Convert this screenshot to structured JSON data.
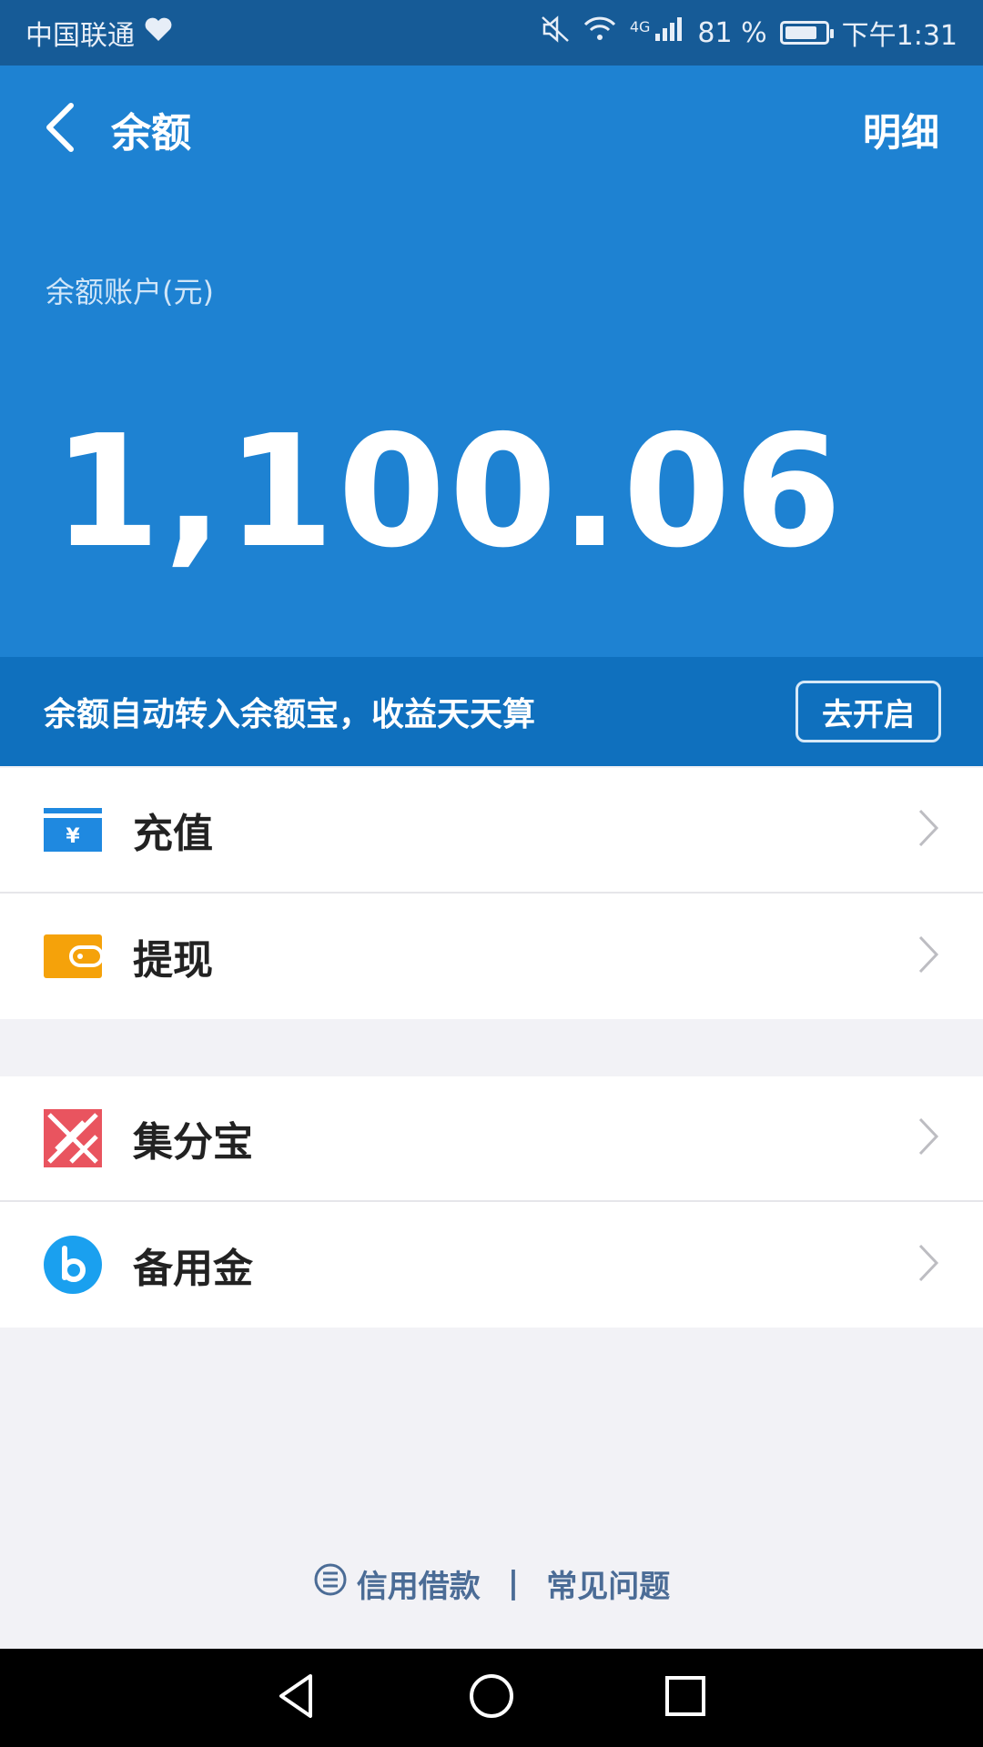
{
  "status_bar": {
    "carrier": "中国联通",
    "battery": "81 %",
    "time": "下午1:31",
    "network": "4G",
    "battery_level": 0.81
  },
  "header": {
    "title": "余额",
    "detail_label": "明细",
    "balance_label": "余额账户(元)",
    "balance_amount": "1,100.06"
  },
  "promo": {
    "text": "余额自动转入余额宝，收益天天算",
    "button_label": "去开启"
  },
  "menu_group_1": [
    {
      "label": "充值",
      "icon": "recharge-card-icon"
    },
    {
      "label": "提现",
      "icon": "wallet-icon"
    }
  ],
  "menu_group_2": [
    {
      "label": "集分宝",
      "icon": "jifenbao-icon"
    },
    {
      "label": "备用金",
      "icon": "beiyongjin-icon"
    }
  ],
  "footer": {
    "credit_loan": "信用借款",
    "separator": "|",
    "faq": "常见问题"
  },
  "colors": {
    "header_blue": "#1e82d2",
    "promo_blue": "#0f70be",
    "status_blue": "#165b97",
    "recharge_blue": "#1f89e0",
    "wallet_orange": "#f5a20a",
    "jifenbao_red": "#e9545f",
    "beiyongjin_blue": "#1aa0ef"
  }
}
